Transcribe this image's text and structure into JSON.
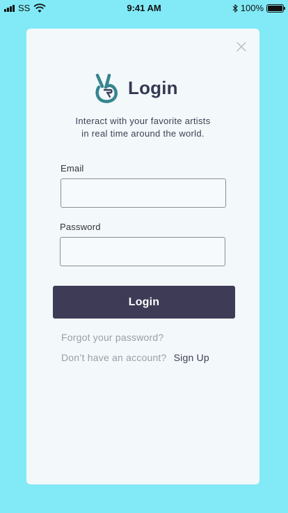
{
  "status_bar": {
    "carrier": "SS",
    "time": "9:41 AM",
    "battery": "100%"
  },
  "login": {
    "title": "Login",
    "subtitle_line1": "Interact with your favorite artists",
    "subtitle_line2": "in real time around the world.",
    "email_label": "Email",
    "email_value": "",
    "password_label": "Password",
    "password_value": "",
    "submit_label": "Login",
    "forgot_label": "Forgot your password?",
    "no_account_label": "Don’t have an account?",
    "signup_label": "Sign Up"
  },
  "icons": {
    "logo": "victory-hand-icon",
    "close": "close-icon"
  },
  "colors": {
    "background": "#81eaf6",
    "card": "#f3f8fb",
    "primary": "#3e3b56",
    "logo_teal": "#2f7f8c",
    "muted_text": "#9a9ea6"
  }
}
